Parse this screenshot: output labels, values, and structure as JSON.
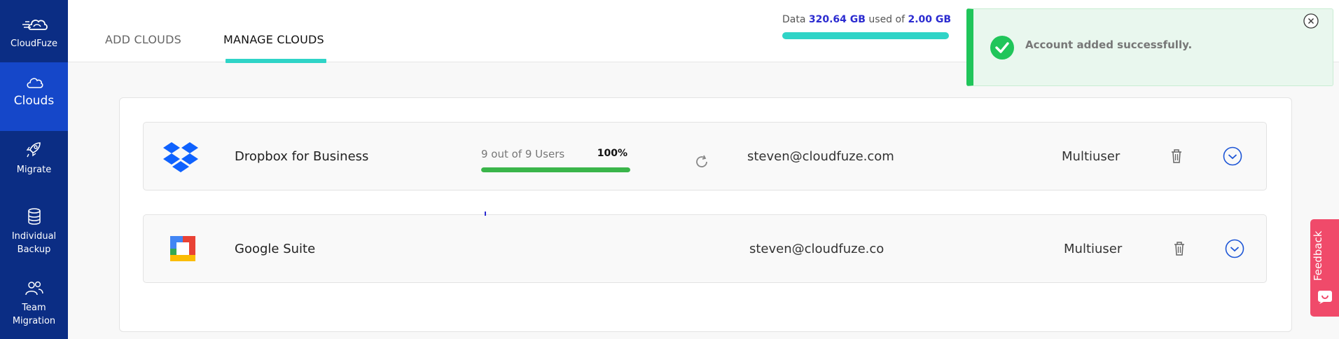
{
  "sidebar": {
    "brand": "CloudFuze",
    "items": [
      {
        "label": "Clouds",
        "icon": "cloud-icon",
        "active": true
      },
      {
        "label": "Migrate",
        "icon": "rocket-icon",
        "active": false
      },
      {
        "label_line1": "Individual",
        "label_line2": "Backup",
        "icon": "database-icon",
        "active": false
      },
      {
        "label_line1": "Team",
        "label_line2": "Migration",
        "icon": "users-icon",
        "active": false
      }
    ]
  },
  "tabs": [
    {
      "label": "ADD CLOUDS",
      "active": false
    },
    {
      "label": "MANAGE CLOUDS",
      "active": true
    }
  ],
  "storage": {
    "prefix": "Data",
    "used": "320.64 GB",
    "middle": "used of",
    "total": "2.00 GB",
    "bar_color": "#2fd4c7"
  },
  "toast": {
    "message": "Account added successfully.",
    "type": "success",
    "accent": "#20c55a"
  },
  "clouds": [
    {
      "name": "Dropbox for Business",
      "logo": "dropbox-logo",
      "progress_text": "9 out of 9 Users",
      "progress_pct": "100%",
      "progress_value": 1.0,
      "email": "steven@cloudfuze.com",
      "type": "Multiuser"
    },
    {
      "name": "Google Suite",
      "logo": "google-suite-logo",
      "email": "steven@cloudfuze.co",
      "type": "Multiuser"
    }
  ],
  "feedback": {
    "label": "Feedback",
    "color": "#f04a6a"
  },
  "colors": {
    "sidebar": "#0b2d84",
    "sidebar_active": "#1547c9",
    "accent_blue": "#2b2bd0",
    "progress_green": "#3ab54a"
  }
}
